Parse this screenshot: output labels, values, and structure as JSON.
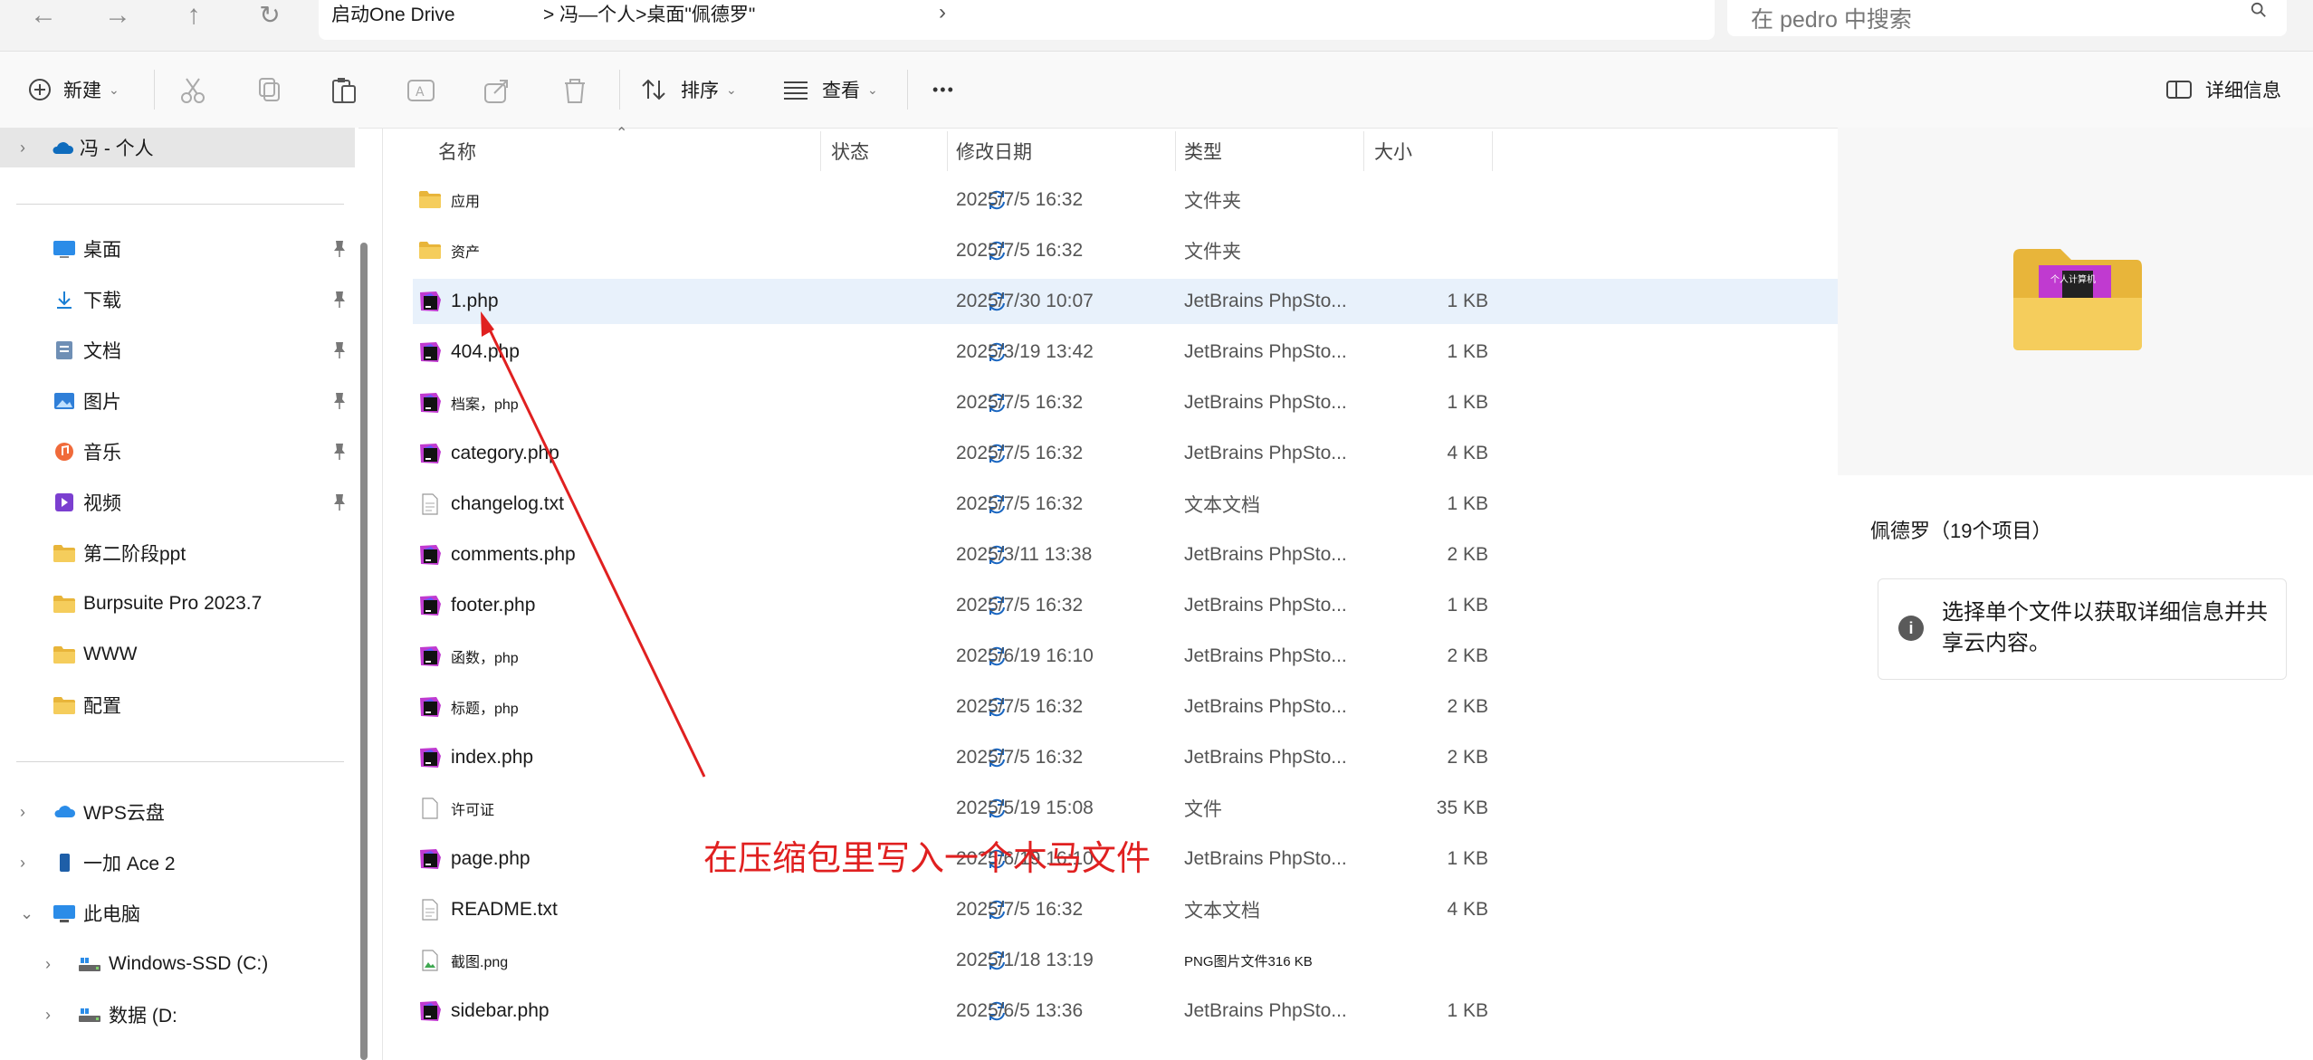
{
  "address": {
    "segments": [
      "启动One Drive",
      "> 冯—个人>桌面\"佩德罗\""
    ],
    "search_placeholder": "在 pedro 中搜索"
  },
  "toolbar": {
    "new_label": "新建",
    "sort_label": "排序",
    "view_label": "查看",
    "more_label": "•••",
    "details_label": "详细信息"
  },
  "nav": {
    "root": "冯 - 个人",
    "quick": [
      {
        "label": "桌面",
        "icon": "desktop-icon",
        "pinned": true
      },
      {
        "label": "下载",
        "icon": "download-icon",
        "pinned": true
      },
      {
        "label": "文档",
        "icon": "document-icon",
        "pinned": true
      },
      {
        "label": "图片",
        "icon": "picture-icon",
        "pinned": true
      },
      {
        "label": "音乐",
        "icon": "music-icon",
        "pinned": true
      },
      {
        "label": "视频",
        "icon": "video-icon",
        "pinned": true
      },
      {
        "label": "第二阶段ppt",
        "icon": "folder-icon",
        "pinned": false
      },
      {
        "label": "Burpsuite Pro 2023.7",
        "icon": "folder-icon",
        "pinned": false
      },
      {
        "label": "WWW",
        "icon": "folder-icon",
        "pinned": false
      },
      {
        "label": "配置",
        "icon": "folder-icon",
        "pinned": false
      }
    ],
    "devices": [
      {
        "label": "WPS云盘",
        "icon": "cloud-icon",
        "expand": ">"
      },
      {
        "label": "一加 Ace 2",
        "icon": "phone-icon",
        "expand": ">"
      },
      {
        "label": "此电脑",
        "icon": "computer-icon",
        "expand": "v"
      },
      {
        "label": "Windows-SSD (C:)",
        "icon": "drive-icon",
        "expand": ">"
      },
      {
        "label": "数据  (D:",
        "icon": "drive-icon",
        "expand": ">"
      }
    ]
  },
  "columns": [
    "名称",
    "状态",
    "修改日期",
    "类型",
    "大小"
  ],
  "files": [
    {
      "name": "应用",
      "date": "2025/7/5 16:32",
      "type": "文件夹",
      "size": "",
      "icon": "folder-icon",
      "small": true
    },
    {
      "name": "资产",
      "date": "2025/7/5 16:32",
      "type": "文件夹",
      "size": "",
      "icon": "folder-icon",
      "small": true
    },
    {
      "name": "1.php",
      "date": "2025/7/30 10:07",
      "type": "JetBrains PhpSto...",
      "size": "1 KB",
      "icon": "phpstorm-icon",
      "selected": true
    },
    {
      "name": "404.php",
      "date": "2025/3/19 13:42",
      "type": "JetBrains PhpSto...",
      "size": "1 KB",
      "icon": "phpstorm-icon"
    },
    {
      "name": "档案，php",
      "date": "2025/7/5 16:32",
      "type": "JetBrains PhpSto...",
      "size": "1 KB",
      "icon": "phpstorm-icon",
      "small": true
    },
    {
      "name": "category.php",
      "date": "2025/7/5 16:32",
      "type": "JetBrains PhpSto...",
      "size": "4 KB",
      "icon": "phpstorm-icon"
    },
    {
      "name": "changelog.txt",
      "date": "2025/7/5 16:32",
      "type": "文本文档",
      "size": "1 KB",
      "icon": "text-file-icon"
    },
    {
      "name": "comments.php",
      "date": "2025/3/11 13:38",
      "type": "JetBrains PhpSto...",
      "size": "2 KB",
      "icon": "phpstorm-icon"
    },
    {
      "name": "footer.php",
      "date": "2025/7/5 16:32",
      "type": "JetBrains PhpSto...",
      "size": "1 KB",
      "icon": "phpstorm-icon"
    },
    {
      "name": "函数，php",
      "date": "2025/6/19 16:10",
      "type": "JetBrains PhpSto...",
      "size": "2 KB",
      "icon": "phpstorm-icon",
      "small": true
    },
    {
      "name": "标题，php",
      "date": "2025/7/5 16:32",
      "type": "JetBrains PhpSto...",
      "size": "2 KB",
      "icon": "phpstorm-icon",
      "small": true
    },
    {
      "name": "index.php",
      "date": "2025/7/5 16:32",
      "type": "JetBrains PhpSto...",
      "size": "2 KB",
      "icon": "phpstorm-icon"
    },
    {
      "name": "许可证",
      "date": "2025/5/19 15:08",
      "type": "文件",
      "size": "35 KB",
      "icon": "file-icon",
      "small": true
    },
    {
      "name": "page.php",
      "date": "2025/6/19 16:10",
      "type": "JetBrains PhpSto...",
      "size": "1 KB",
      "icon": "phpstorm-icon"
    },
    {
      "name": "README.txt",
      "date": "2025/7/5 16:32",
      "type": "文本文档",
      "size": "4 KB",
      "icon": "text-file-icon"
    },
    {
      "name": "截图.png",
      "date": "2025/1/18 13:19",
      "type": "PNG图片文件316 KB",
      "size": "",
      "icon": "image-file-icon",
      "small": true,
      "typeSmall": true
    },
    {
      "name": "sidebar.php",
      "date": "2025/6/5 13:36",
      "type": "JetBrains PhpSto...",
      "size": "1 KB",
      "icon": "phpstorm-icon"
    }
  ],
  "details": {
    "folder_badge": "个人计算机",
    "title": "佩德罗（19个项目）",
    "info": "选择单个文件以获取详细信息并共享云内容。"
  },
  "annotation": "在压缩包里写入一个木马文件",
  "colors": {
    "accent": "#0067c0",
    "annotation": "#e02020",
    "selected_row": "#e8f1fb",
    "folder": "#f2c94c",
    "phpstorm": "#c03ad0"
  }
}
